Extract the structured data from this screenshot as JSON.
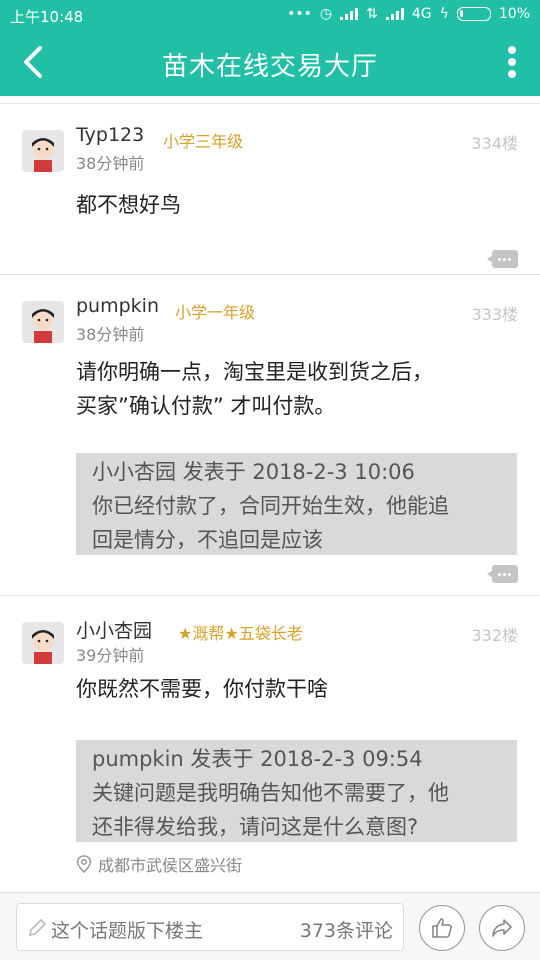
{
  "status": {
    "time": "上午10:48",
    "network": "4G",
    "battery": "10%"
  },
  "header": {
    "title": "苗木在线交易大厅"
  },
  "posts": [
    {
      "username": "Typ123",
      "rank": "小学三年级",
      "time": "38分钟前",
      "floor": "334楼",
      "content": [
        "都不想好鸟"
      ]
    },
    {
      "username": "pumpkin",
      "rank": "小学一年级",
      "time": "38分钟前",
      "floor": "333楼",
      "content": [
        "请你明确一点，淘宝里是收到货之后，",
        "买家”确认付款” 才叫付款。"
      ],
      "quote": {
        "header": "小小杏园 发表于 2018-2-3 10:06",
        "lines": [
          "你已经付款了，合同开始生效，他能追",
          "回是情分，不追回是应该"
        ]
      }
    },
    {
      "username": "小小杏园",
      "rank": "★溉帮★五袋长老",
      "time": "39分钟前",
      "floor": "332楼",
      "content": [
        "你既然不需要，你付款干啥"
      ],
      "quote": {
        "header": "pumpkin 发表于 2018-2-3 09:54",
        "lines": [
          "关键问题是我明确告知他不需要了，他",
          "还非得发给我，请问这是什么意图?"
        ]
      },
      "location": "成都市武侯区盛兴街"
    }
  ],
  "bottom": {
    "placeholder": "这个话题版下楼主",
    "comment_count": "373条评论"
  },
  "colors": {
    "accent": "#21c0a6",
    "rank": "#d6a22a"
  },
  "icons": [
    "back-arrow-icon",
    "more-vert-icon",
    "comment-icon",
    "location-pin-icon",
    "pencil-icon",
    "thumbs-up-icon",
    "share-icon"
  ]
}
